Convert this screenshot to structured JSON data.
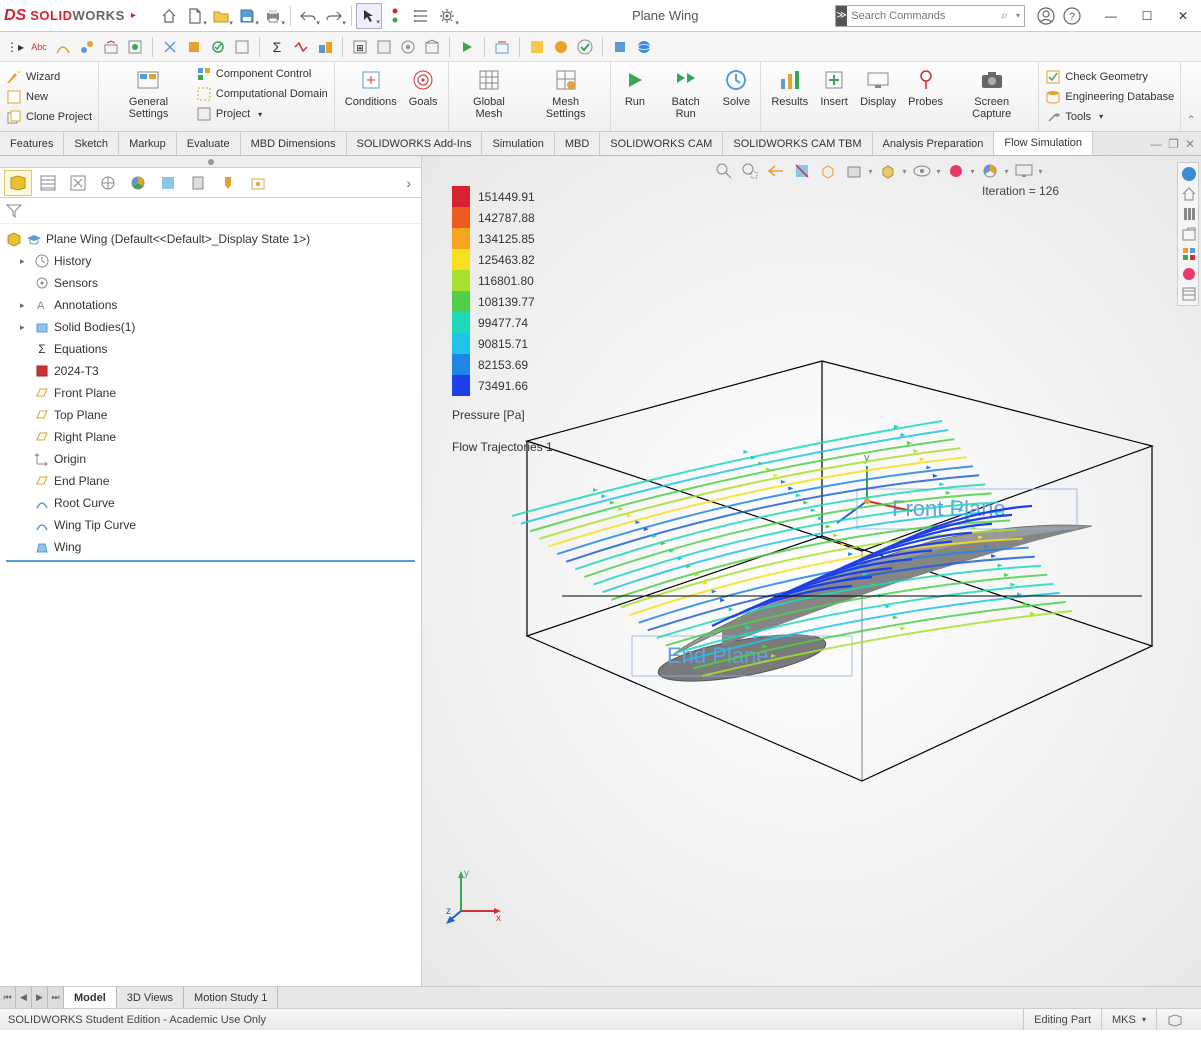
{
  "app": {
    "logo_text_1": "SOLID",
    "logo_text_2": "WORKS",
    "doc_title": "Plane Wing",
    "search_placeholder": "Search Commands"
  },
  "ribbon": {
    "wizard": "Wizard",
    "new": "New",
    "clone_project": "Clone Project",
    "general_settings": "General\nSettings",
    "component_control": "Component Control",
    "computational_domain": "Computational Domain",
    "project": "Project",
    "conditions": "Conditions",
    "goals": "Goals",
    "global_mesh": "Global\nMesh",
    "mesh_settings": "Mesh\nSettings",
    "run": "Run",
    "batch_run": "Batch\nRun",
    "solve": "Solve",
    "results": "Results",
    "insert": "Insert",
    "display": "Display",
    "probes": "Probes",
    "screen_capture": "Screen\nCapture",
    "check_geometry": "Check Geometry",
    "engineering_database": "Engineering Database",
    "tools": "Tools"
  },
  "tabs": [
    "Features",
    "Sketch",
    "Markup",
    "Evaluate",
    "MBD Dimensions",
    "SOLIDWORKS Add-Ins",
    "Simulation",
    "MBD",
    "SOLIDWORKS CAM",
    "SOLIDWORKS CAM TBM",
    "Analysis Preparation",
    "Flow Simulation"
  ],
  "active_tab": "Flow Simulation",
  "tree": {
    "root": "Plane Wing  (Default<<Default>_Display State 1>)",
    "items": [
      {
        "label": "History",
        "exp": true
      },
      {
        "label": "Sensors",
        "exp": false
      },
      {
        "label": "Annotations",
        "exp": true
      },
      {
        "label": "Solid Bodies(1)",
        "exp": true
      },
      {
        "label": "Equations",
        "exp": false
      },
      {
        "label": "2024-T3",
        "exp": false
      },
      {
        "label": "Front Plane",
        "exp": false
      },
      {
        "label": "Top Plane",
        "exp": false
      },
      {
        "label": "Right Plane",
        "exp": false
      },
      {
        "label": "Origin",
        "exp": false
      },
      {
        "label": "End Plane",
        "exp": false
      },
      {
        "label": "Root Curve",
        "exp": false
      },
      {
        "label": "Wing Tip Curve",
        "exp": false
      },
      {
        "label": "Wing",
        "exp": false
      }
    ]
  },
  "viewport": {
    "iteration_label": "Iteration = ",
    "iteration_value": "126",
    "legend_values": [
      "151449.91",
      "142787.88",
      "134125.85",
      "125463.82",
      "116801.80",
      "108139.77",
      "99477.74",
      "90815.71",
      "82153.69",
      "73491.66"
    ],
    "legend_colors": [
      "#d92231",
      "#ef5a1f",
      "#f7a51e",
      "#f7e01e",
      "#a8e02e",
      "#4fd048",
      "#1fd8b8",
      "#1fc4e8",
      "#1f86e8",
      "#1f3fe8"
    ],
    "legend_label": "Pressure [Pa]",
    "legend_sub": "Flow Trajectories 1",
    "plane_labels": {
      "front": "Front Plane",
      "end": "End Plane"
    },
    "axis_labels": {
      "x": "x",
      "y": "y",
      "z": "z"
    }
  },
  "bottom_tabs": [
    "Model",
    "3D Views",
    "Motion Study 1"
  ],
  "active_bottom_tab": "Model",
  "status": {
    "left": "SOLIDWORKS Student Edition - Academic Use Only",
    "mode": "Editing Part",
    "units": "MKS"
  }
}
